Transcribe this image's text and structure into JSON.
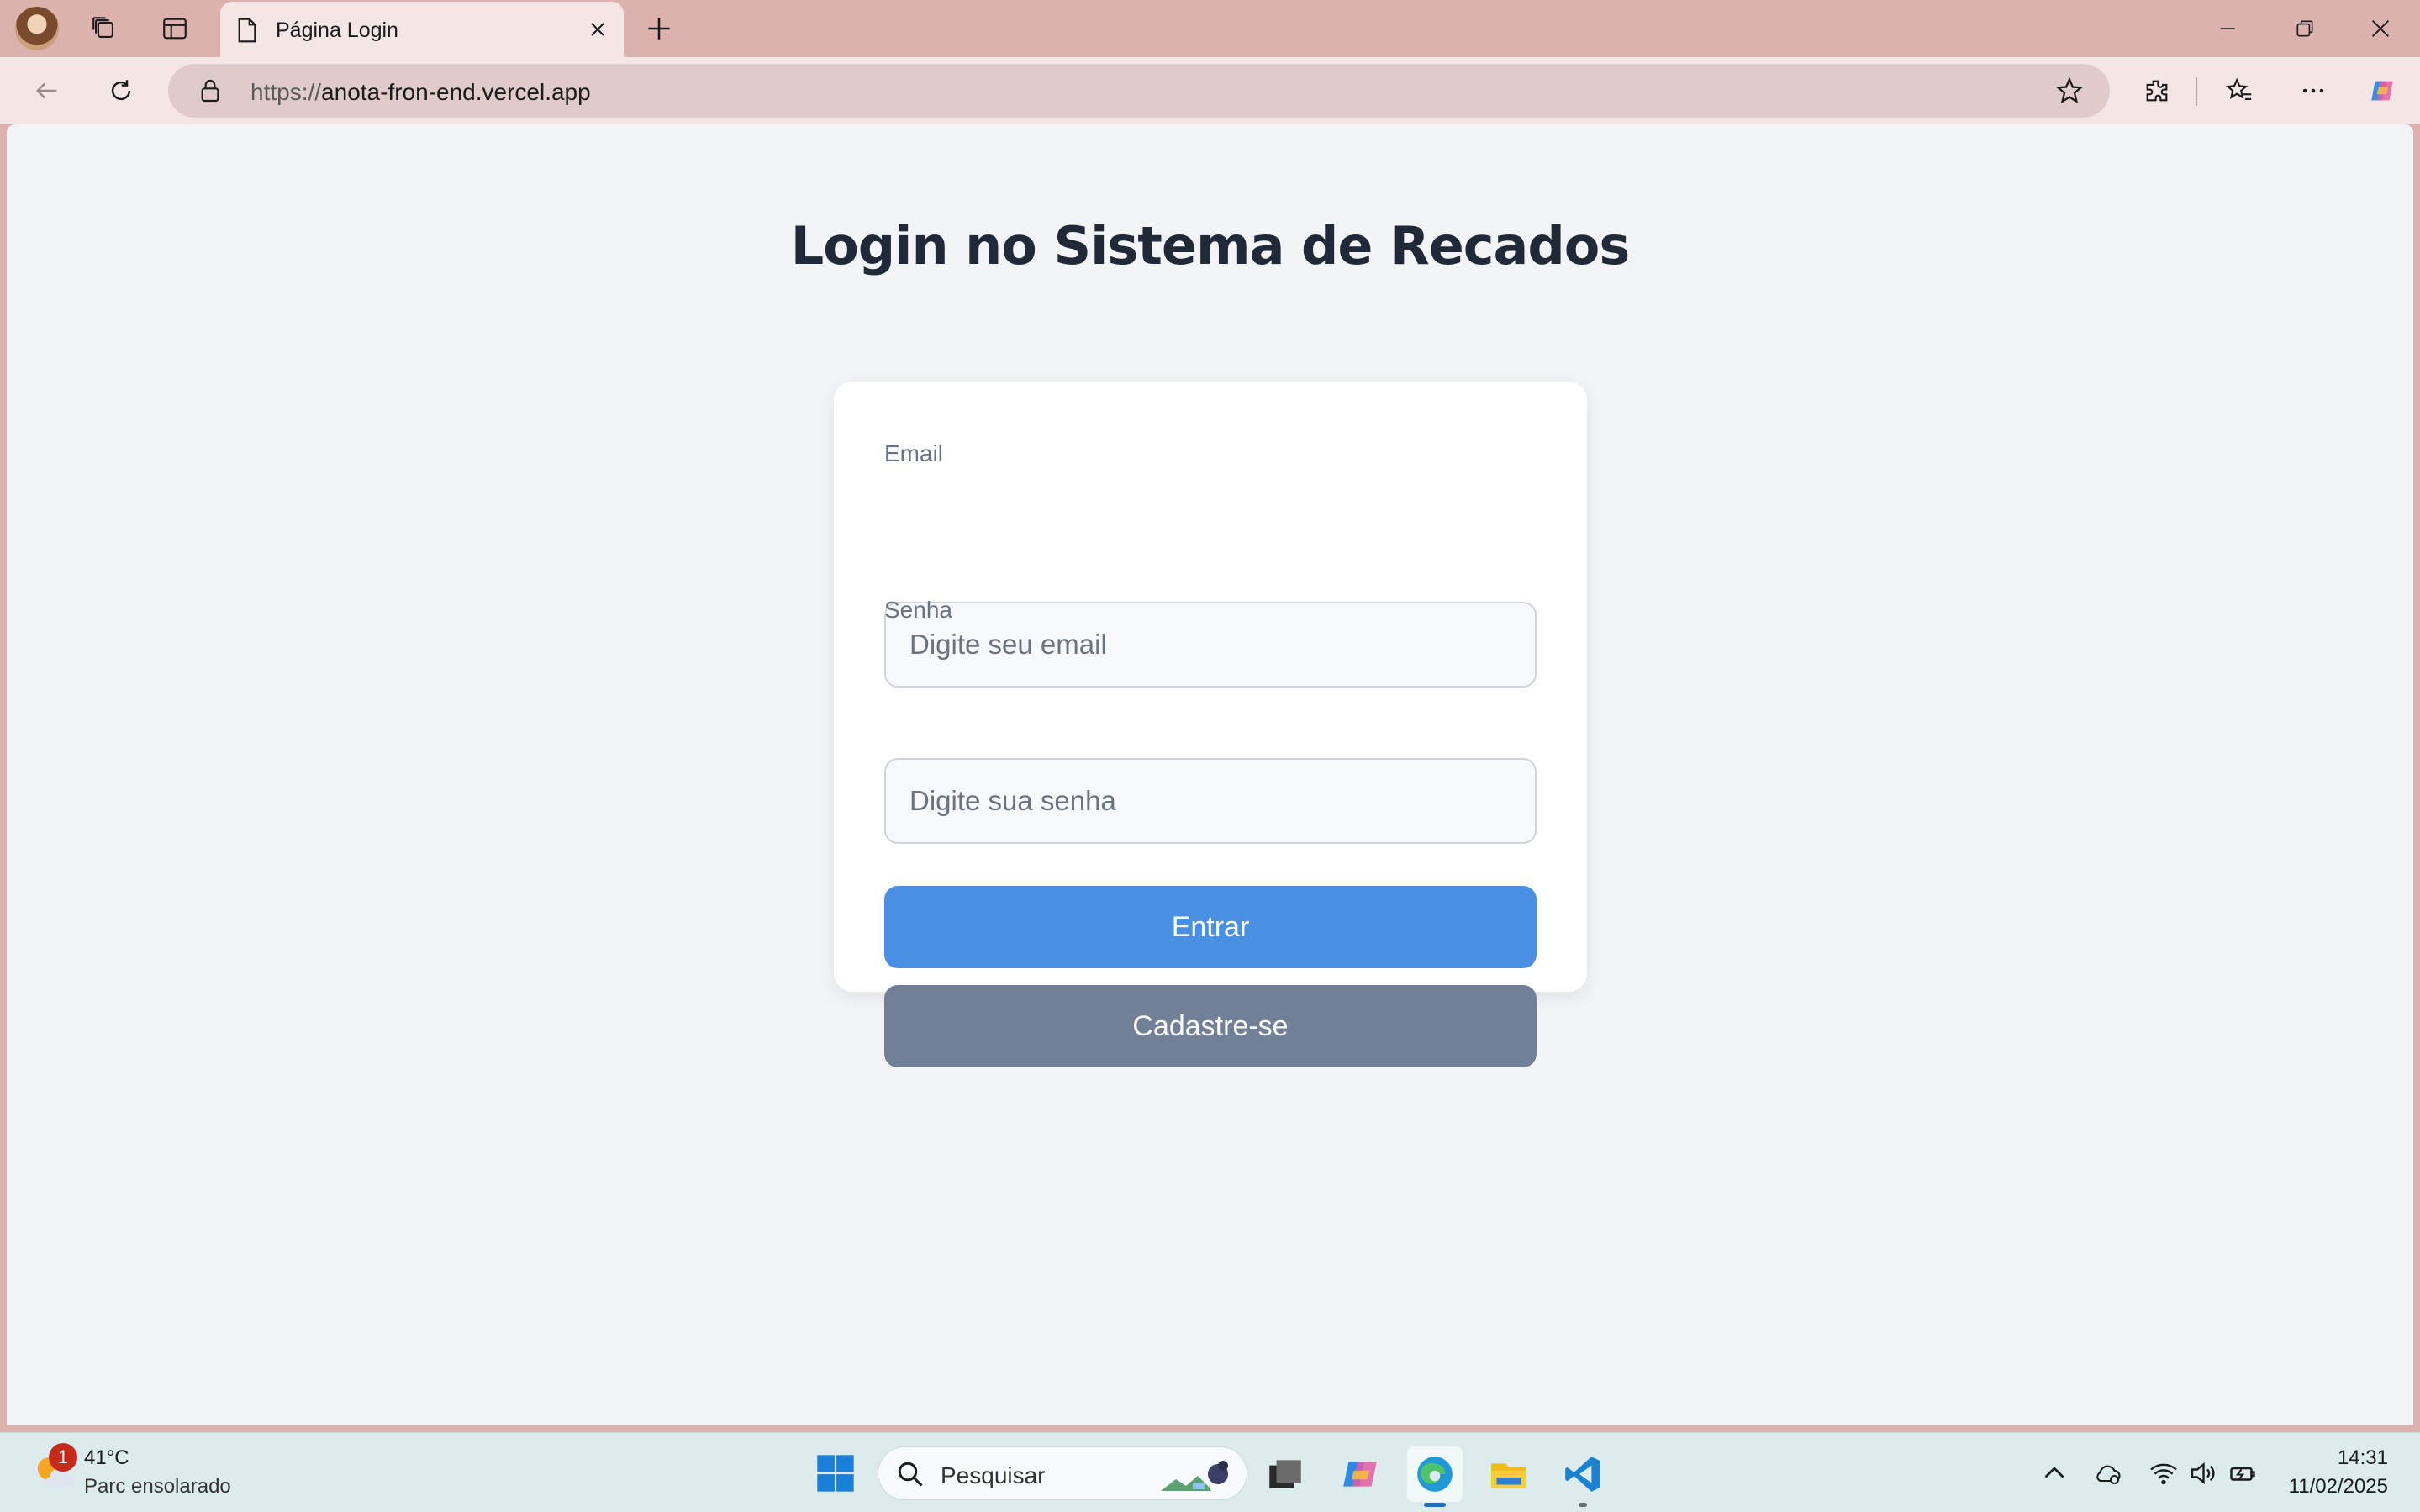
{
  "browser": {
    "tab_title": "Página Login",
    "url_protocol": "https://",
    "url_host": "anota-fron-end.vercel.app"
  },
  "page": {
    "title": "Login no Sistema de Recados",
    "form": {
      "email_label": "Email",
      "email_placeholder": "Digite seu email",
      "email_value": "",
      "password_label": "Senha",
      "password_placeholder": "Digite sua senha",
      "password_value": "",
      "login_button": "Entrar",
      "signup_button": "Cadastre-se"
    }
  },
  "taskbar": {
    "weather_badge": "1",
    "weather_temp": "41°C",
    "weather_desc": "Parc ensolarado",
    "search_placeholder": "Pesquisar",
    "time": "14:31",
    "date": "11/02/2025"
  },
  "colors": {
    "primary_button": "#4a90e2",
    "secondary_button": "#718096",
    "page_background": "#f3f4f6",
    "browser_frame": "#dbb2ae"
  }
}
